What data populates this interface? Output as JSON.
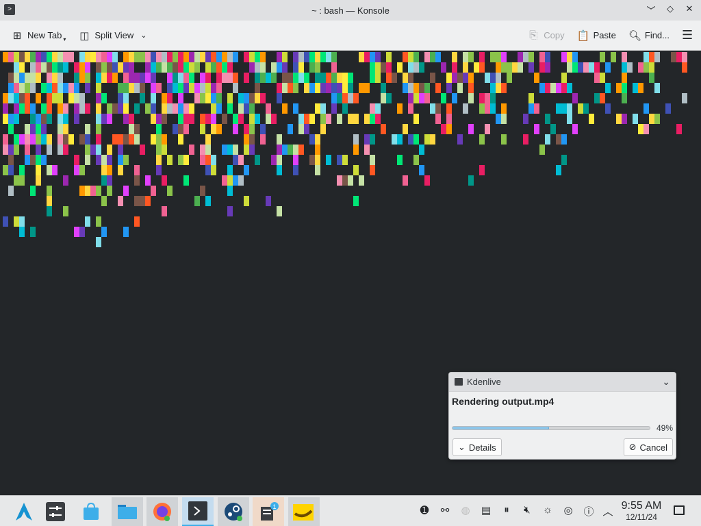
{
  "window": {
    "title": "~ : bash — Konsole",
    "controls": [
      "minimize",
      "maximize",
      "close"
    ]
  },
  "toolbar": {
    "new_tab": "New Tab",
    "split_view": "Split View",
    "copy": "Copy",
    "paste": "Paste",
    "find": "Find..."
  },
  "notification": {
    "app": "Kdenlive",
    "title": "Rendering output.mp4",
    "progress": 0.49,
    "progress_label": "49%",
    "details_label": "Details",
    "cancel_label": "Cancel"
  },
  "taskbar": {
    "apps": [
      {
        "name": "app-launcher",
        "icon": "arch-logo"
      },
      {
        "name": "system-settings",
        "icon": "settings-sliders"
      },
      {
        "name": "discover",
        "icon": "store-bag"
      },
      {
        "name": "dolphin",
        "icon": "folder"
      },
      {
        "name": "firefox",
        "icon": "firefox"
      },
      {
        "name": "konsole",
        "icon": "terminal"
      },
      {
        "name": "steam",
        "icon": "steam"
      },
      {
        "name": "kdenlive",
        "icon": "film",
        "badge": "1"
      },
      {
        "name": "bananas",
        "icon": "banana"
      }
    ],
    "tray_icons": [
      "updates-icon",
      "network-share-icon",
      "disabled-icon",
      "clipboard-icon",
      "media-pause-icon",
      "volume-muted-icon",
      "brightness-icon",
      "network-icon",
      "help-icon",
      "expand-tray-icon"
    ],
    "clock": {
      "time": "9:55 AM",
      "date": "12/11/24"
    }
  },
  "colors": {
    "terminal_bg": "#232629",
    "accent": "#3daee9",
    "pixel_palette": [
      "#e91e63",
      "#00bcd4",
      "#8bc34a",
      "#ffeb3b",
      "#9c27b0",
      "#3f51b5",
      "#ff9800",
      "#4caf50",
      "#f48fb1",
      "#80deea",
      "#c5e1a5",
      "#2196f3",
      "#ff5722",
      "#009688",
      "#cddc39",
      "#673ab7",
      "#e040fb",
      "#00e676",
      "#ffd740",
      "#795548",
      "#b0bec5",
      "#f06292"
    ]
  }
}
